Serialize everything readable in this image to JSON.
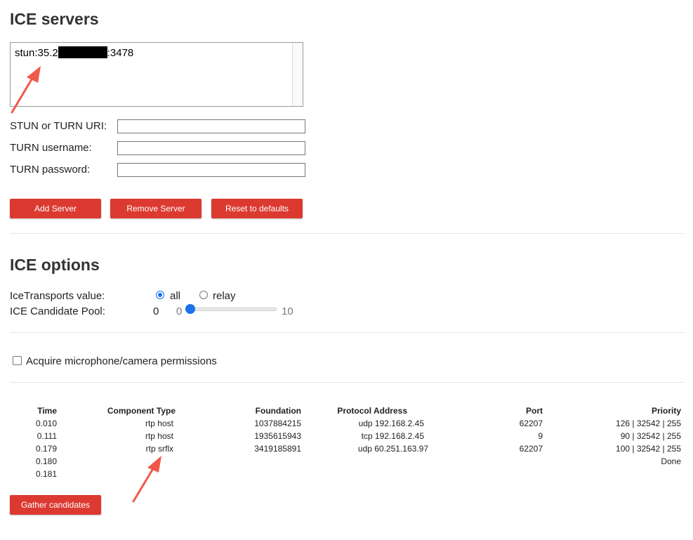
{
  "ice_servers": {
    "title": "ICE servers",
    "server_list": {
      "prefix": "stun:35.2",
      "suffix": ":3478"
    },
    "uri_label": "STUN or TURN URI:",
    "username_label": "TURN username:",
    "password_label": "TURN password:",
    "add_button": "Add Server",
    "remove_button": "Remove Server",
    "reset_button": "Reset to defaults"
  },
  "ice_options": {
    "title": "ICE options",
    "transports_label": "IceTransports value:",
    "transport_all": "all",
    "transport_relay": "relay",
    "selected_transport": "all",
    "pool_label": "ICE Candidate Pool:",
    "pool_value": "0",
    "slider_min": "0",
    "slider_max": "10"
  },
  "permissions": {
    "checkbox_label": "Acquire microphone/camera permissions",
    "checked": false
  },
  "candidates": {
    "headers": {
      "time": "Time",
      "component_type": "Component Type",
      "foundation": "Foundation",
      "protocol_address": "Protocol Address",
      "port": "Port",
      "priority": "Priority"
    },
    "rows": [
      {
        "time": "0.010",
        "component_type": "rtp host",
        "foundation": "1037884215",
        "protocol_address": "udp 192.168.2.45",
        "port": "62207",
        "priority": "126 | 32542 | 255"
      },
      {
        "time": "0.111",
        "component_type": "rtp host",
        "foundation": "1935615943",
        "protocol_address": "tcp 192.168.2.45",
        "port": "9",
        "priority": "90 | 32542 | 255"
      },
      {
        "time": "0.179",
        "component_type": "rtp srflx",
        "foundation": "3419185891",
        "protocol_address": "udp 60.251.163.97",
        "port": "62207",
        "priority": "100 | 32542 | 255"
      },
      {
        "time": "0.180",
        "component_type": "",
        "foundation": "",
        "protocol_address": "",
        "port": "",
        "priority": "Done"
      },
      {
        "time": "0.181",
        "component_type": "",
        "foundation": "",
        "protocol_address": "",
        "port": "",
        "priority": ""
      }
    ],
    "gather_button": "Gather candidates"
  },
  "colors": {
    "button_red": "#dc3a31",
    "annotation_arrow": "#f0584a",
    "radio_blue": "#1a73e8"
  }
}
